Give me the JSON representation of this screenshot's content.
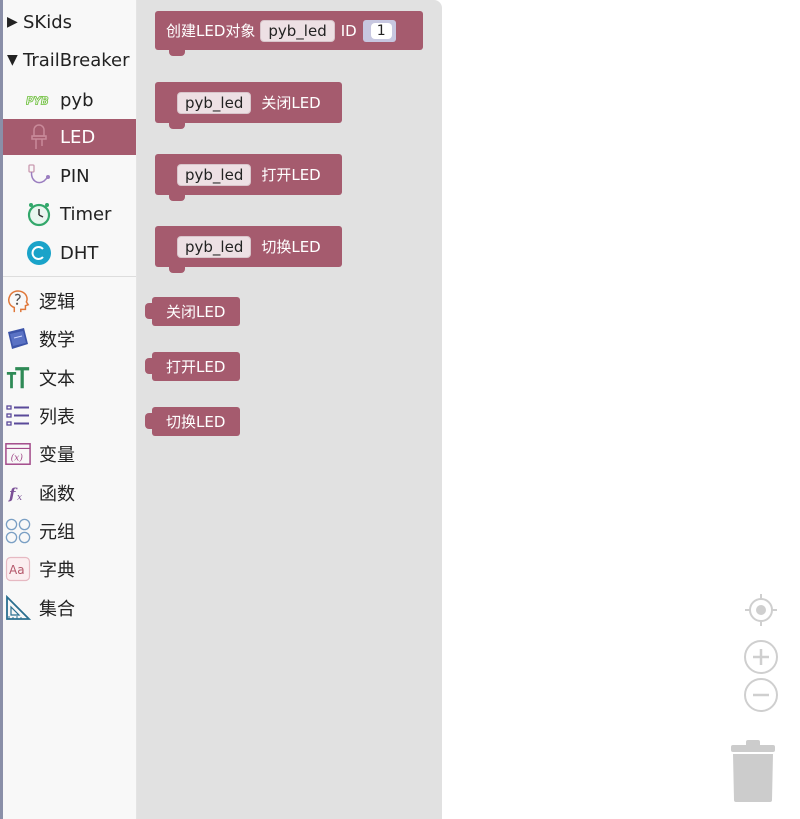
{
  "toolbox": {
    "skids": "SKids",
    "trailbreaker": "TrailBreaker",
    "sub": {
      "pyb": "pyb",
      "pyb_badge": "PYB",
      "led": "LED",
      "pin": "PIN",
      "timer": "Timer",
      "dht": "DHT"
    },
    "categories": {
      "logic": "逻辑",
      "math": "数学",
      "text": "文本",
      "lists": "列表",
      "variables": "变量",
      "functions": "函数",
      "tuple": "元组",
      "dict": "字典",
      "set": "集合"
    },
    "selected": "LED"
  },
  "flyout": {
    "create": {
      "prefix": "创建LED对象",
      "var": "pyb_led",
      "id_label": "ID",
      "id_value": "1"
    },
    "b_off": {
      "var": "pyb_led",
      "action": "关闭LED"
    },
    "b_on": {
      "var": "pyb_led",
      "action": "打开LED"
    },
    "b_toggle": {
      "var": "pyb_led",
      "action": "切换LED"
    },
    "v_off": "关闭LED",
    "v_on": "打开LED",
    "v_toggle": "切换LED"
  },
  "colors": {
    "block": "#a55b6e",
    "flyout_bg": "#e1e1e1",
    "toolbox_bg": "#f8f8f8"
  }
}
